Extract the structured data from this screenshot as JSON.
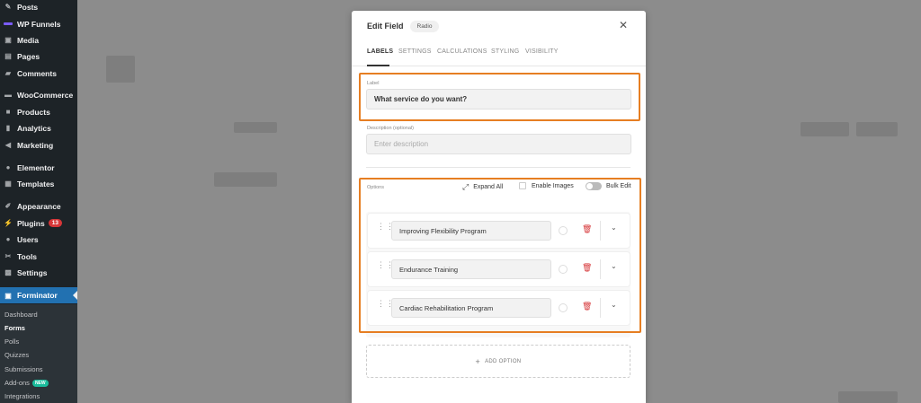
{
  "sidebar": {
    "items": [
      {
        "label": "Posts",
        "icon": "pin-icon"
      },
      {
        "label": "WP Funnels",
        "icon": "funnel-icon"
      },
      {
        "label": "Media",
        "icon": "media-icon"
      },
      {
        "label": "Pages",
        "icon": "page-icon"
      },
      {
        "label": "Comments",
        "icon": "comment-icon"
      },
      {
        "label": "WooCommerce",
        "icon": "woo-icon"
      },
      {
        "label": "Products",
        "icon": "box-icon"
      },
      {
        "label": "Analytics",
        "icon": "bar-chart-icon"
      },
      {
        "label": "Marketing",
        "icon": "megaphone-icon"
      },
      {
        "label": "Elementor",
        "icon": "elementor-icon"
      },
      {
        "label": "Templates",
        "icon": "folder-icon"
      },
      {
        "label": "Appearance",
        "icon": "brush-icon"
      },
      {
        "label": "Plugins",
        "icon": "plug-icon",
        "badge": "13"
      },
      {
        "label": "Users",
        "icon": "user-icon"
      },
      {
        "label": "Tools",
        "icon": "wrench-icon"
      },
      {
        "label": "Settings",
        "icon": "settings-icon"
      },
      {
        "label": "Forminator",
        "icon": "forminator-icon"
      }
    ],
    "submenu": [
      {
        "label": "Dashboard"
      },
      {
        "label": "Forms"
      },
      {
        "label": "Polls"
      },
      {
        "label": "Quizzes"
      },
      {
        "label": "Submissions"
      },
      {
        "label": "Add-ons",
        "badge": "NEW"
      },
      {
        "label": "Integrations"
      }
    ]
  },
  "modal": {
    "title": "Edit Field",
    "type_badge": "Radio",
    "tabs": [
      "LABELS",
      "SETTINGS",
      "CALCULATIONS",
      "STYLING",
      "VISIBILITY"
    ],
    "label_field": {
      "label": "Label",
      "value": "What service do you want?"
    },
    "description_field": {
      "label": "Description (optional)",
      "placeholder": "Enter description"
    },
    "options_header": {
      "label": "Options",
      "expand_all": "Expand All",
      "enable_images": "Enable Images",
      "bulk_edit": "Bulk Edit"
    },
    "options": [
      {
        "label": "Improving Flexibility Program"
      },
      {
        "label": "Endurance Training"
      },
      {
        "label": "Cardiac Rehabilitation Program"
      }
    ],
    "add_option": "ADD OPTION"
  },
  "colors": {
    "highlight": "#e67e22",
    "sidebar_bg": "#1d2327",
    "active_menu": "#2271b1",
    "delete": "#d63638"
  }
}
